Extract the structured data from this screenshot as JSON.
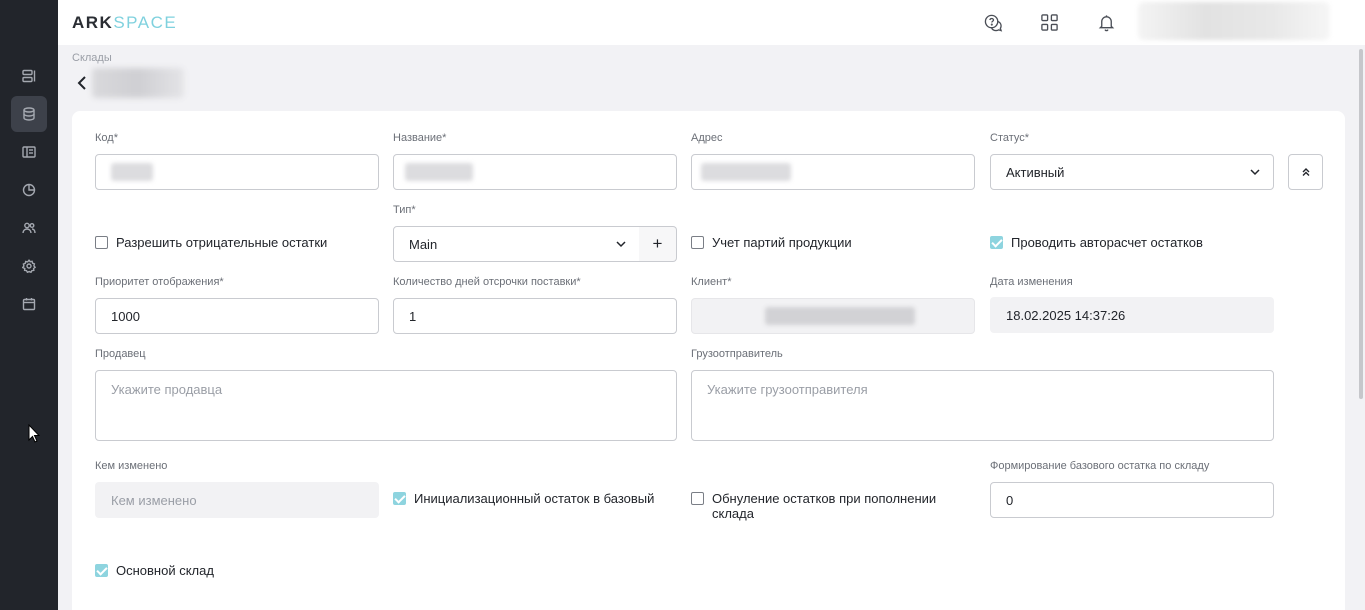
{
  "app": {
    "logo_ark": "ARK",
    "logo_space": "SPACE"
  },
  "sidebar": {
    "items": [
      {
        "icon": "list-icon"
      },
      {
        "icon": "database-icon",
        "active": true
      },
      {
        "icon": "layout-icon"
      },
      {
        "icon": "pie-chart-icon"
      },
      {
        "icon": "users-icon"
      },
      {
        "icon": "gear-icon"
      },
      {
        "icon": "calendar-icon"
      }
    ]
  },
  "header": {
    "icons": [
      "help-chat-icon",
      "apps-grid-icon",
      "bell-icon"
    ]
  },
  "breadcrumb": "Склады",
  "form": {
    "code": {
      "label": "Код*"
    },
    "name": {
      "label": "Название*"
    },
    "address": {
      "label": "Адрес"
    },
    "status": {
      "label": "Статус*",
      "value": "Активный"
    },
    "allow_negative": {
      "label": "Разрешить отрицательные остатки",
      "checked": false
    },
    "type": {
      "label": "Тип*",
      "value": "Main",
      "add": "+"
    },
    "batch_tracking": {
      "label": "Учет партий продукции",
      "checked": false
    },
    "auto_calc": {
      "label": "Проводить авторасчет остатков",
      "checked": true
    },
    "priority": {
      "label": "Приоритет отображения*",
      "value": "1000"
    },
    "delay_days": {
      "label": "Количество дней отсрочки поставки*",
      "value": "1"
    },
    "client": {
      "label": "Клиент*"
    },
    "changed_date": {
      "label": "Дата изменения",
      "value": "18.02.2025 14:37:26"
    },
    "seller": {
      "label": "Продавец",
      "placeholder": "Укажите продавца"
    },
    "shipper": {
      "label": "Грузоотправитель",
      "placeholder": "Укажите грузоотправителя"
    },
    "changed_by": {
      "label": "Кем изменено",
      "placeholder": "Кем изменено"
    },
    "init_balance": {
      "label": "Инициализационный остаток в базовый",
      "checked": true
    },
    "reset_on_refill": {
      "label_line1": "Обнуление остатков при пополнении",
      "label_line2": "склада",
      "checked": false
    },
    "base_balance": {
      "label": "Формирование базового остатка по складу",
      "value": "0"
    },
    "main_warehouse": {
      "label": "Основной склад",
      "checked": true
    }
  },
  "colors": {
    "sidebar_bg": "#22252b",
    "accent": "#8ed4df",
    "logo_space": "#7fd1de"
  }
}
